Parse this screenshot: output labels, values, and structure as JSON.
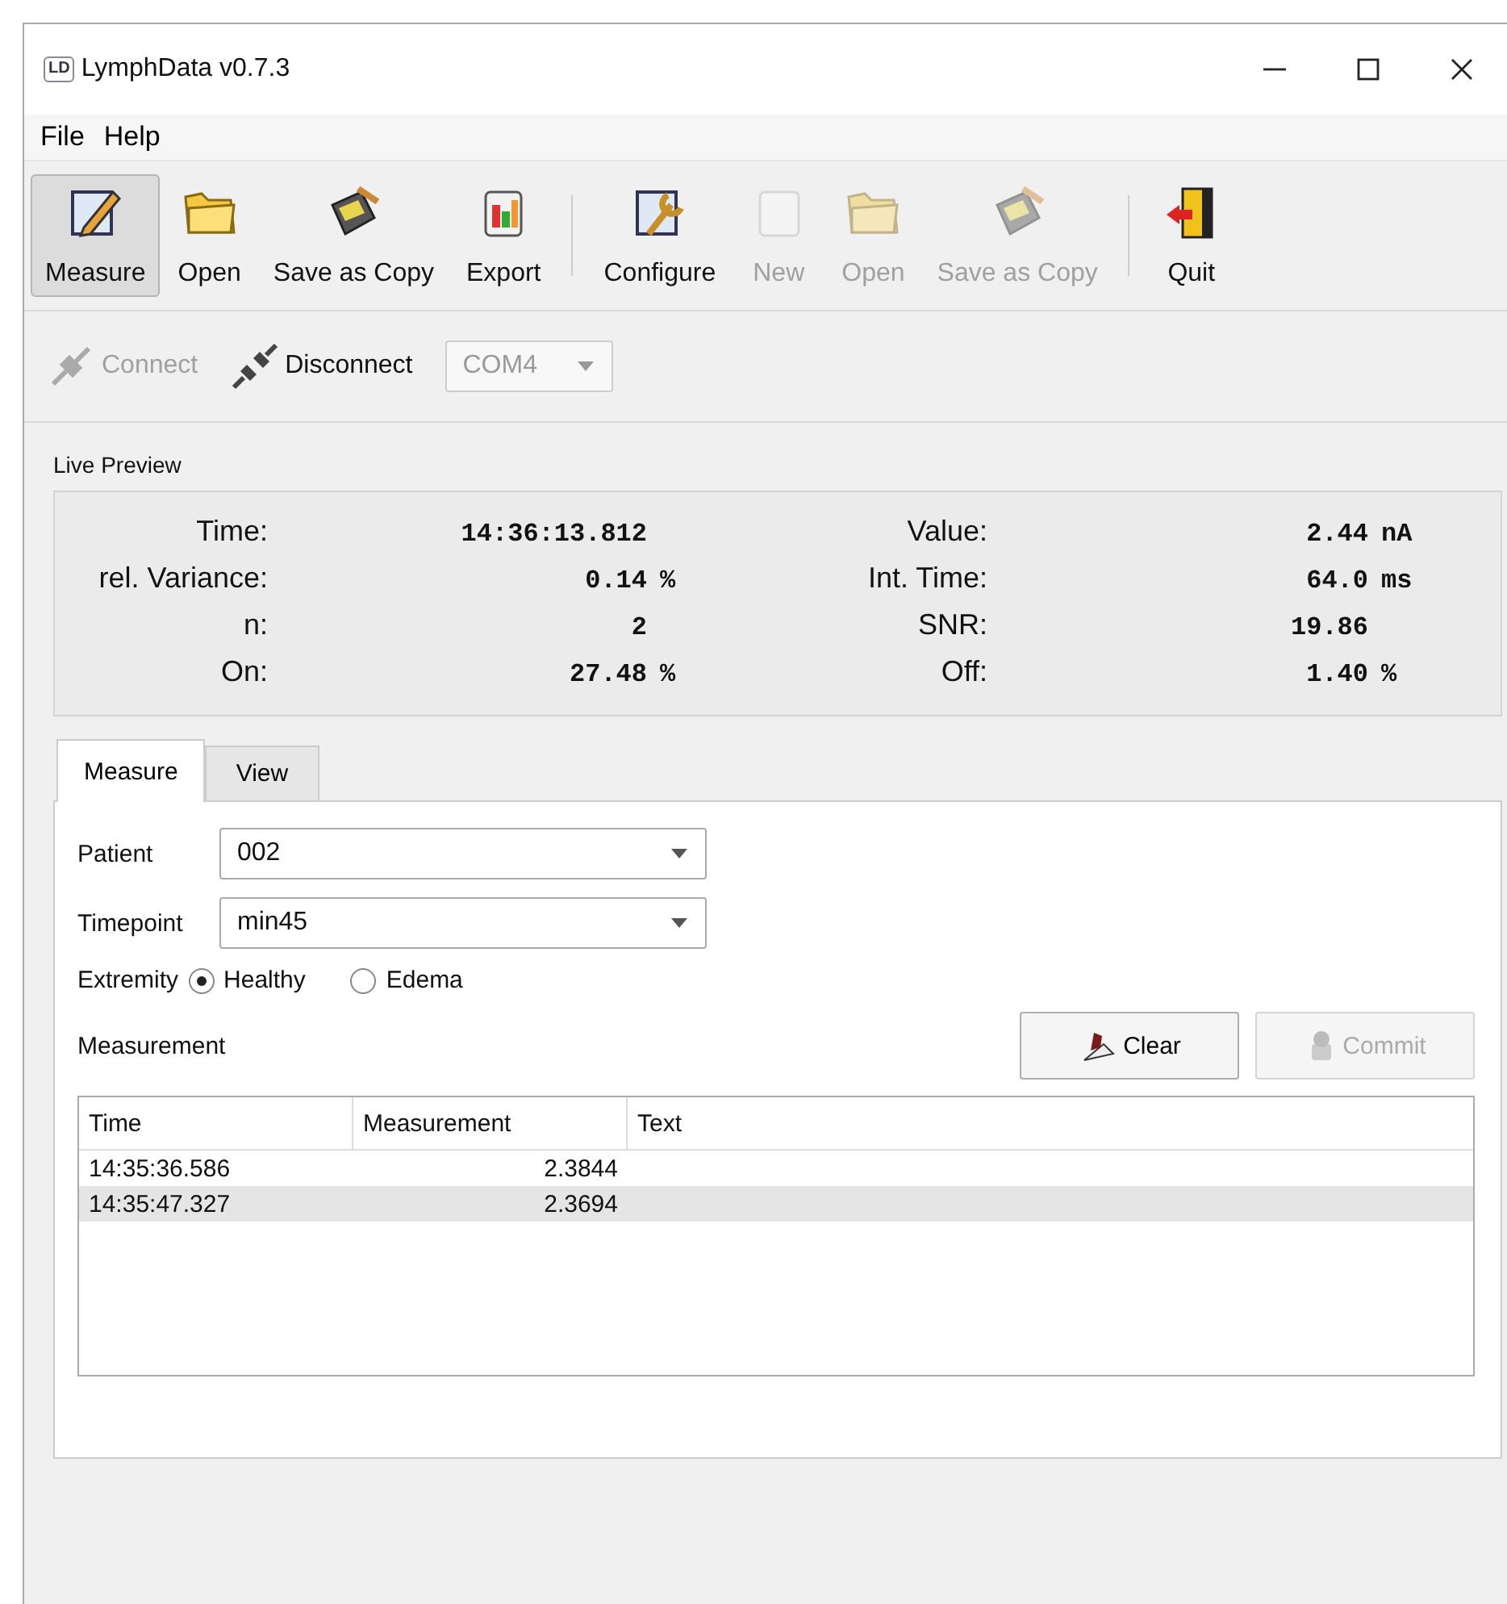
{
  "window": {
    "logo_text": "LD",
    "title": "LymphData v0.7.3"
  },
  "menu": [
    "File",
    "Help"
  ],
  "toolbar": {
    "groups": [
      [
        {
          "kind": "pencil",
          "label": "Measure",
          "selected": true,
          "disabled": false
        },
        {
          "kind": "folder",
          "label": "Open",
          "selected": false,
          "disabled": false
        },
        {
          "kind": "save",
          "label": "Save as Copy",
          "selected": false,
          "disabled": false
        },
        {
          "kind": "export",
          "label": "Export",
          "selected": false,
          "disabled": false
        }
      ],
      [
        {
          "kind": "wrench",
          "label": "Configure",
          "selected": false,
          "disabled": false
        },
        {
          "kind": "blank",
          "label": "New",
          "selected": false,
          "disabled": true
        },
        {
          "kind": "folder",
          "label": "Open",
          "selected": false,
          "disabled": true
        },
        {
          "kind": "save",
          "label": "Save as Copy",
          "selected": false,
          "disabled": true
        }
      ],
      [
        {
          "kind": "quit",
          "label": "Quit",
          "selected": false,
          "disabled": false
        }
      ]
    ]
  },
  "connection": {
    "buttons": [
      {
        "label": "Connect",
        "disabled": true
      },
      {
        "label": "Disconnect",
        "disabled": false
      }
    ],
    "port": {
      "value": "COM4",
      "disabled": true
    }
  },
  "live_preview": {
    "title": "Live Preview",
    "fields": [
      {
        "label": "Time:",
        "value": "14:36:13.812"
      },
      {
        "label": "Value:",
        "value": "2.44",
        "unit": "nA"
      },
      {
        "label": "rel. Variance:",
        "value": "0.14",
        "unit": "%"
      },
      {
        "label": "Int. Time:",
        "value": "64.0",
        "unit": "ms"
      },
      {
        "label": "n:",
        "value": "2"
      },
      {
        "label": "SNR:",
        "value": "19.86"
      },
      {
        "label": "On:",
        "value": "27.48",
        "unit": "%"
      },
      {
        "label": "Off:",
        "value": "1.40",
        "unit": "%"
      }
    ]
  },
  "tabs": [
    {
      "label": "Measure",
      "selected": true
    },
    {
      "label": "View",
      "selected": false
    }
  ],
  "form": {
    "patient": {
      "label": "Patient",
      "value": "002"
    },
    "timepoint": {
      "label": "Timepoint",
      "value": "min45"
    },
    "extremity": {
      "label": "Extremity",
      "options": [
        {
          "label": "Healthy",
          "selected": true
        },
        {
          "label": "Edema",
          "selected": false
        }
      ]
    }
  },
  "measurement": {
    "title": "Measurement",
    "buttons": [
      {
        "kind": "clear",
        "label": "Clear",
        "disabled": false
      },
      {
        "kind": "commit",
        "label": "Commit",
        "disabled": true
      }
    ],
    "table": {
      "columns": [
        "Time",
        "Measurement",
        "Text"
      ],
      "rows": [
        {
          "cells": [
            "14:35:36.586",
            "2.3844"
          ],
          "selected": false
        },
        {
          "cells": [
            "14:35:47.327",
            "2.3694"
          ],
          "selected": true
        }
      ]
    }
  }
}
